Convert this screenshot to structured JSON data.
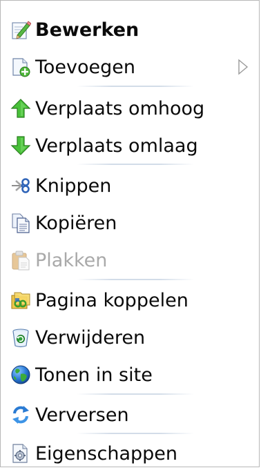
{
  "menu": {
    "items": [
      {
        "label": "Bewerken",
        "icon": "edit-icon"
      },
      {
        "label": "Toevoegen",
        "icon": "add-page-icon",
        "has_submenu": true
      },
      {
        "label": "Verplaats omhoog",
        "icon": "arrow-up-icon"
      },
      {
        "label": "Verplaats omlaag",
        "icon": "arrow-down-icon"
      },
      {
        "label": "Knippen",
        "icon": "scissors-icon"
      },
      {
        "label": "Kopiëren",
        "icon": "copy-icon"
      },
      {
        "label": "Plakken",
        "icon": "paste-icon",
        "disabled": true
      },
      {
        "label": "Pagina koppelen",
        "icon": "link-pages-icon"
      },
      {
        "label": "Verwijderen",
        "icon": "recycle-bin-icon"
      },
      {
        "label": "Tonen in site",
        "icon": "globe-icon"
      },
      {
        "label": "Verversen",
        "icon": "refresh-icon"
      },
      {
        "label": "Eigenschappen",
        "icon": "properties-icon"
      }
    ]
  },
  "colors": {
    "text": "#0a0a0a",
    "disabled_text": "#a9a9a9",
    "separator": "#d2dce8",
    "border": "#b7b7b7"
  }
}
